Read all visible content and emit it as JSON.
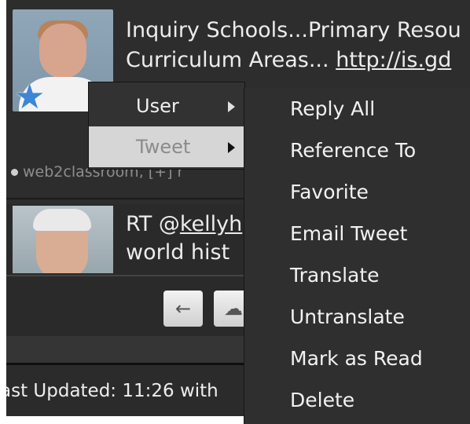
{
  "tweets": [
    {
      "text_line1": "Inquiry Schools...Primary Resou",
      "text_line2_prefix": "Curriculum Areas... ",
      "link_text": "http://is.gd",
      "meta_text": "web2classroom, [+] r"
    },
    {
      "prefix": "RT @",
      "mention": "kellyh",
      "text_line2": "world hist"
    }
  ],
  "icons": {
    "back": "arrow-left-icon",
    "cloud": "cloud-icon",
    "favorite_star": "star-icon"
  },
  "context_menu": {
    "items": [
      {
        "label": "User",
        "has_submenu": true,
        "highlighted": false
      },
      {
        "label": "Tweet",
        "has_submenu": true,
        "highlighted": true
      }
    ]
  },
  "submenu": {
    "items": [
      "Reply All",
      "Reference To",
      "Favorite",
      "Email Tweet",
      "Translate",
      "Untranslate",
      "Mark as Read",
      "Delete"
    ]
  },
  "status": {
    "text": "ast Updated: 11:26 with"
  },
  "colors": {
    "background": "#2a2a2a",
    "text": "#ececec",
    "menu_highlight": "#d6d6d6",
    "star": "#3d86d6"
  }
}
